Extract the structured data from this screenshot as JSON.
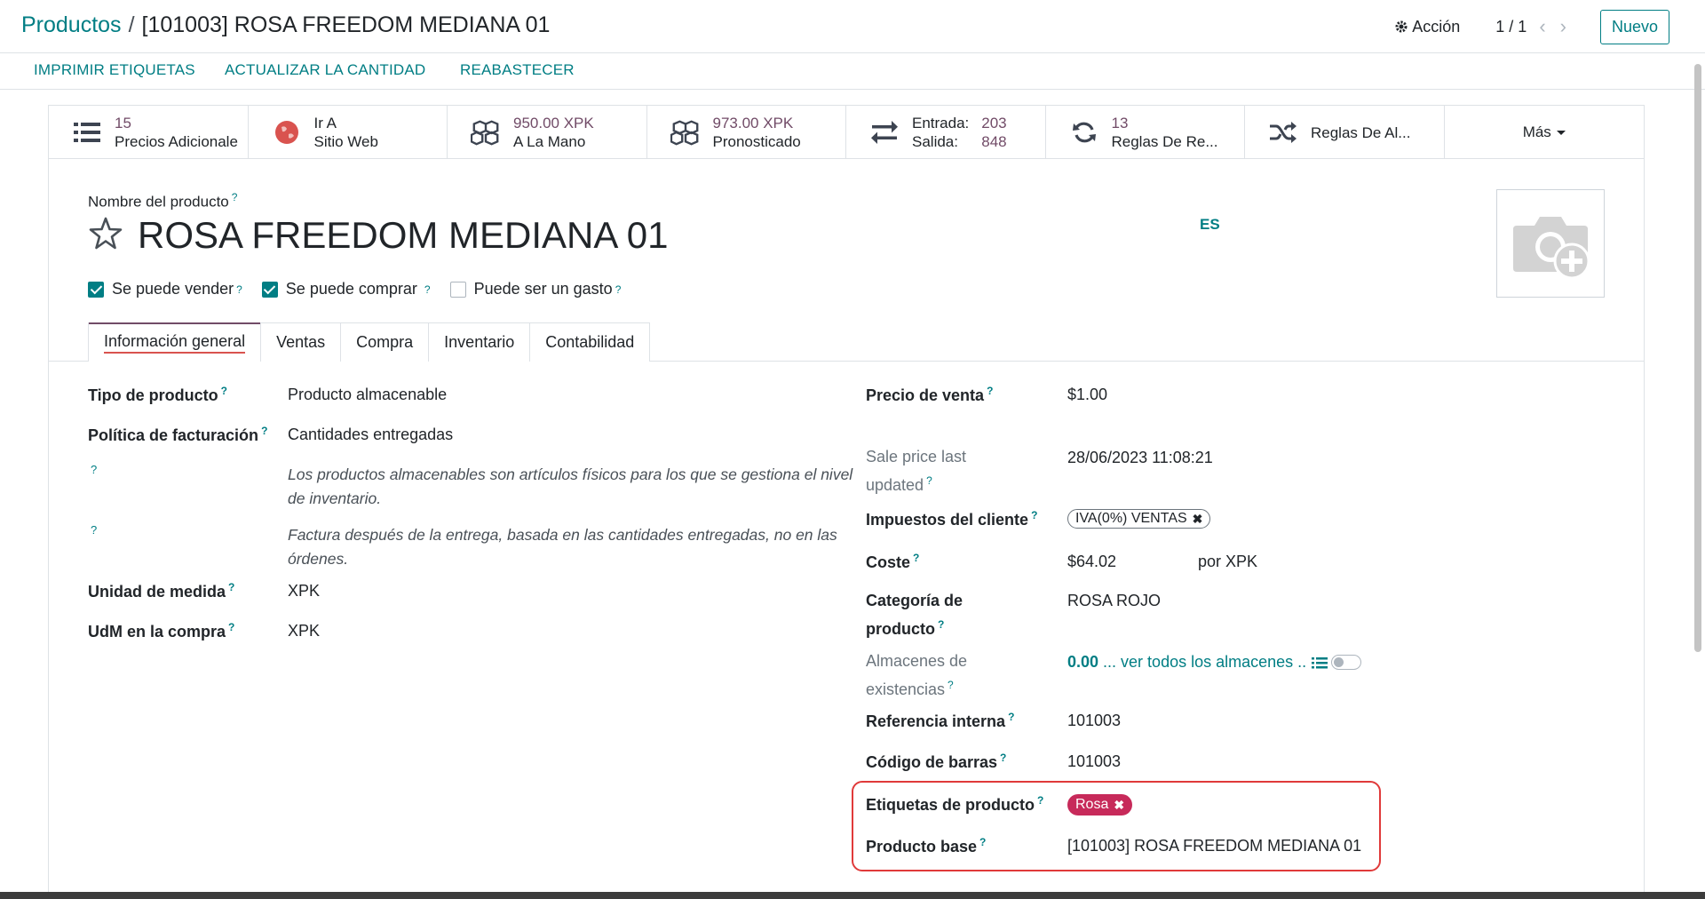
{
  "header": {
    "breadcrumb_parent": "Productos",
    "breadcrumb_current": "[101003] ROSA FREEDOM MEDIANA 01",
    "action_label": "Acción",
    "pager": "1 / 1",
    "new_label": "Nuevo"
  },
  "statusbar": {
    "print_labels": "IMPRIMIR ETIQUETAS",
    "update_qty": "ACTUALIZAR LA CANTIDAD",
    "replenish": "REABASTECER"
  },
  "smart_buttons": {
    "pricelist": {
      "value": "15",
      "label": "Precios Adicionale",
      "icon": "list-icon"
    },
    "website": {
      "value": "Ir A",
      "label": "Sitio Web",
      "icon": "globe-icon"
    },
    "on_hand": {
      "value": "950.00 XPK",
      "label": "A La Mano",
      "icon": "cubes-icon"
    },
    "forecast": {
      "value": "973.00 XPK",
      "label": "Pronosticado",
      "icon": "cubes-icon"
    },
    "in_out": {
      "in_label": "Entrada:",
      "in_value": "203",
      "out_label": "Salida:",
      "out_value": "848",
      "icon": "exchange-icon"
    },
    "reorder": {
      "value": "13",
      "label": "Reglas De Re...",
      "icon": "refresh-icon"
    },
    "routes": {
      "label": "Reglas De Al...",
      "icon": "random-icon"
    },
    "more": {
      "label": "Más"
    }
  },
  "form": {
    "name_label": "Nombre del producto",
    "name": "ROSA FREEDOM MEDIANA 01",
    "lang": "ES",
    "can_sell_label": "Se puede vender",
    "can_buy_label": "Se puede comprar",
    "expense_label": "Puede ser un gasto",
    "tabs": [
      "Información general",
      "Ventas",
      "Compra",
      "Inventario",
      "Contabilidad"
    ]
  },
  "left": {
    "type_label": "Tipo de producto",
    "type_value": "Producto almacenable",
    "invoice_label": "Política de facturación",
    "invoice_value": "Cantidades entregadas",
    "help1": "Los productos almacenables son artículos físicos para los que se gestiona el nivel de inventario.",
    "help2": "Factura después de la entrega, basada en las cantidades entregadas, no en las órdenes.",
    "uom_label": "Unidad de medida",
    "uom_value": "XPK",
    "uom_po_label": "UdM en la compra",
    "uom_po_value": "XPK"
  },
  "right": {
    "price_label": "Precio de venta",
    "price_value": "$1.00",
    "price_updated_label": "Sale price last updated",
    "price_updated_value": "28/06/2023 11:08:21",
    "taxes_label": "Impuestos del cliente",
    "taxes_value": "IVA(0%) VENTAS",
    "cost_label": "Coste",
    "cost_value": "$64.02",
    "cost_per": "por XPK",
    "category_label": "Categoría de producto",
    "category_value": "ROSA ROJO",
    "warehouses_label": "Almacenes de existencias",
    "warehouses_value": "0.00",
    "warehouses_link": "... ver todos los almacenes ..",
    "ref_label": "Referencia interna",
    "ref_value": "101003",
    "barcode_label": "Código de barras",
    "barcode_value": "101003",
    "tags_label": "Etiquetas de producto",
    "tag": "Rosa",
    "base_label": "Producto base",
    "base_value": "[101003] ROSA FREEDOM MEDIANA 01"
  },
  "colors": {
    "accent": "#017e84",
    "brand": "#714b67",
    "tag": "#c72a5a",
    "highlight": "#e03a3a"
  }
}
